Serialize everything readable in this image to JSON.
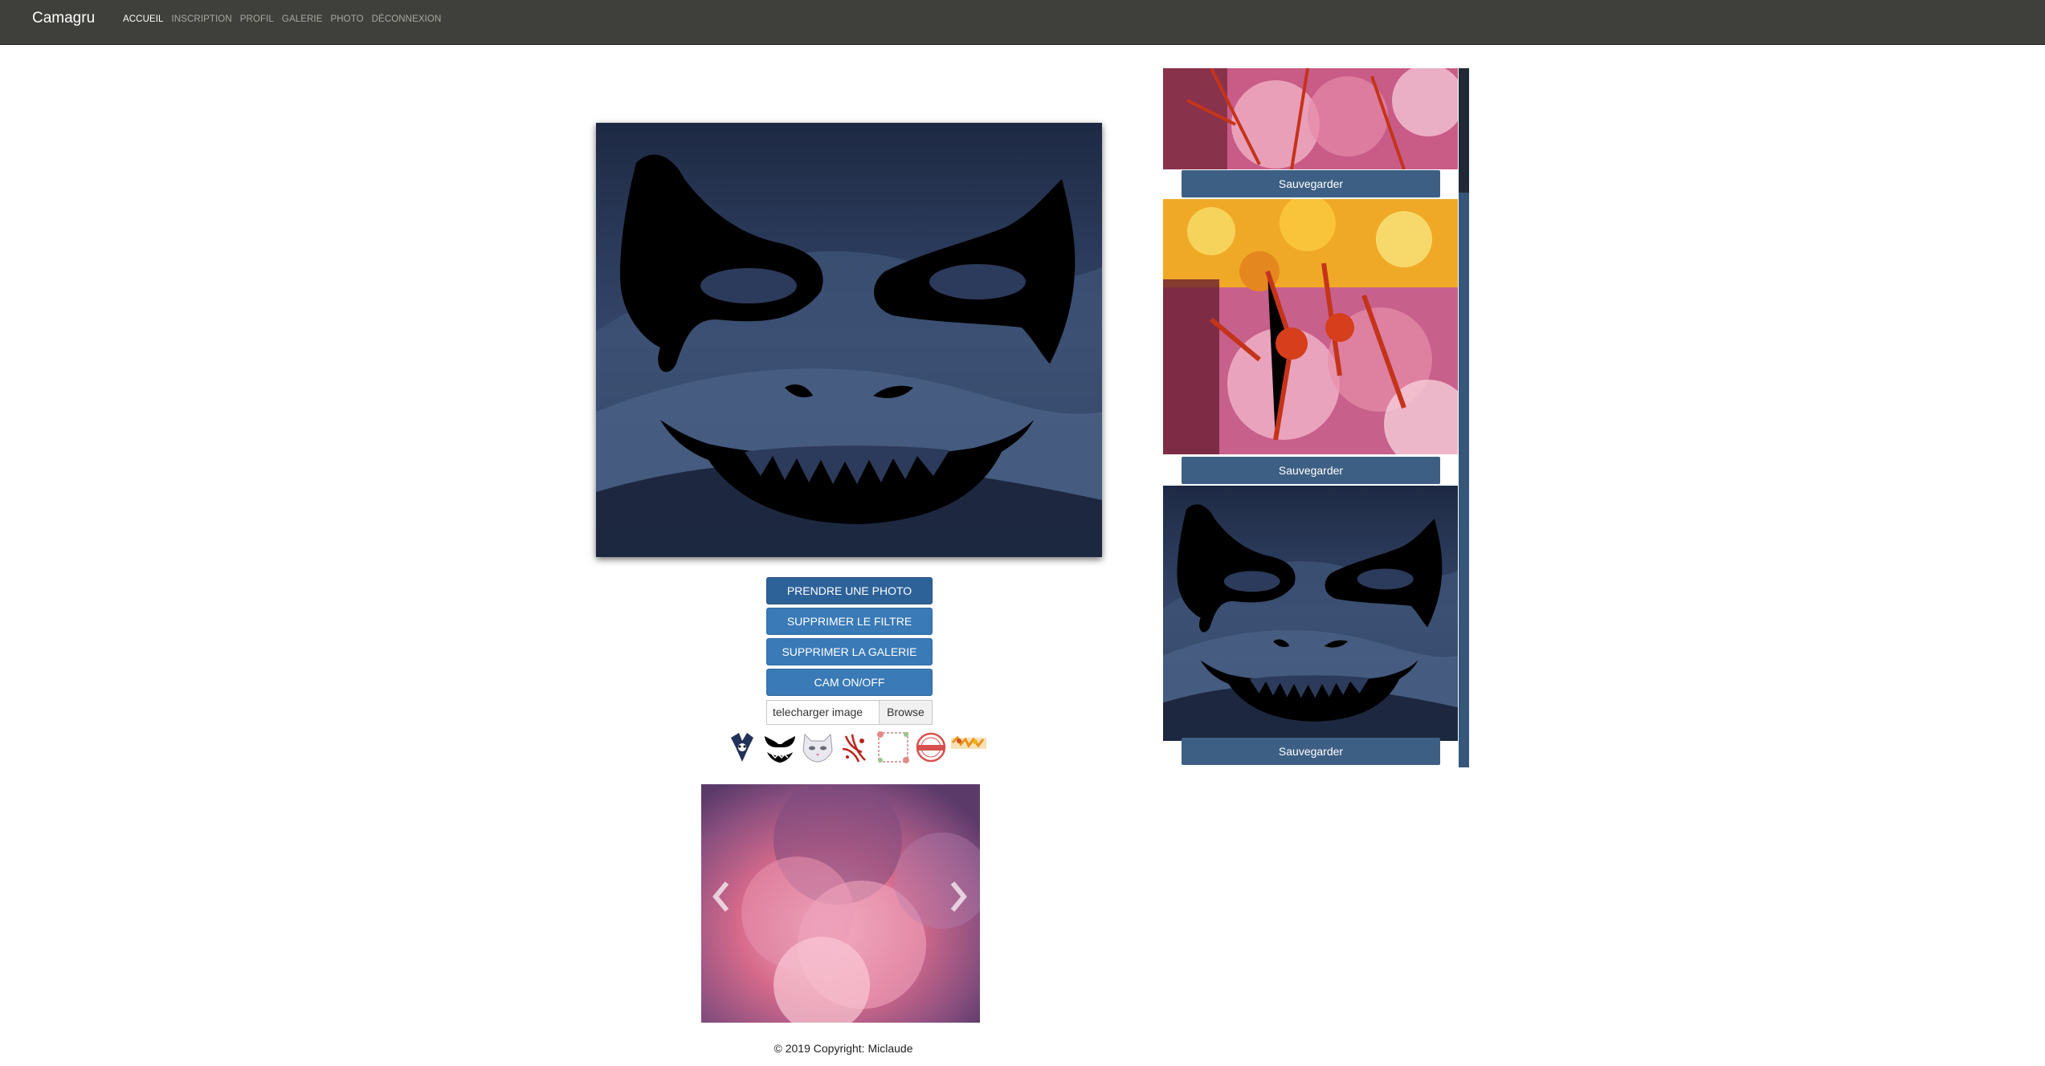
{
  "navbar": {
    "brand": "Camagru",
    "links": [
      {
        "label": "ACCUEIL",
        "active": true
      },
      {
        "label": "INSCRIPTION",
        "active": false
      },
      {
        "label": "PROFIL",
        "active": false
      },
      {
        "label": "GALERIE",
        "active": false
      },
      {
        "label": "PHOTO",
        "active": false
      },
      {
        "label": "DÉCONNEXION",
        "active": false
      }
    ]
  },
  "controls": {
    "take_photo": "PRENDRE UNE PHOTO",
    "remove_filter": "SUPPRIMER LE FILTRE",
    "delete_gallery": "SUPPRIMER LA GALERIE",
    "cam_toggle": "CAM ON/OFF",
    "upload_label": "telecharger image",
    "browse_label": "Browse"
  },
  "filters": [
    "jester-filter-icon",
    "joker-mask-filter-icon",
    "cat-mask-filter-icon",
    "blood-splatter-filter-icon",
    "flower-frame-filter-icon",
    "stamp-filter-icon",
    "autumn-leaves-filter-icon"
  ],
  "gallery": {
    "save_label": "Sauvegarder"
  },
  "footer": {
    "copyright": "© 2019 Copyright: Miclaude"
  },
  "colors": {
    "navbar": "#3f3f3b",
    "button": "#3a7ab7",
    "save_button": "#3d5f84"
  }
}
